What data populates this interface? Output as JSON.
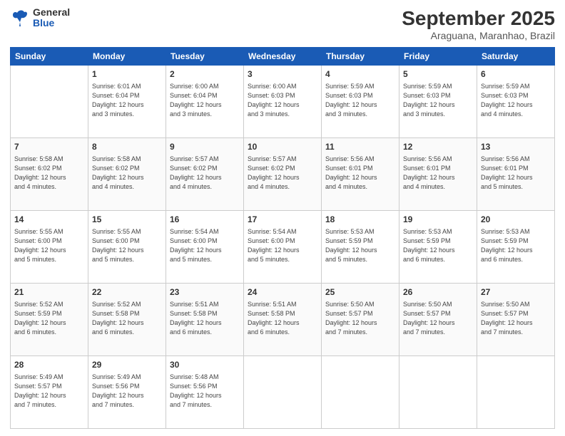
{
  "logo": {
    "general": "General",
    "blue": "Blue"
  },
  "title": "September 2025",
  "subtitle": "Araguana, Maranhao, Brazil",
  "days_of_week": [
    "Sunday",
    "Monday",
    "Tuesday",
    "Wednesday",
    "Thursday",
    "Friday",
    "Saturday"
  ],
  "weeks": [
    [
      {
        "day": "",
        "info": ""
      },
      {
        "day": "1",
        "info": "Sunrise: 6:01 AM\nSunset: 6:04 PM\nDaylight: 12 hours\nand 3 minutes."
      },
      {
        "day": "2",
        "info": "Sunrise: 6:00 AM\nSunset: 6:04 PM\nDaylight: 12 hours\nand 3 minutes."
      },
      {
        "day": "3",
        "info": "Sunrise: 6:00 AM\nSunset: 6:03 PM\nDaylight: 12 hours\nand 3 minutes."
      },
      {
        "day": "4",
        "info": "Sunrise: 5:59 AM\nSunset: 6:03 PM\nDaylight: 12 hours\nand 3 minutes."
      },
      {
        "day": "5",
        "info": "Sunrise: 5:59 AM\nSunset: 6:03 PM\nDaylight: 12 hours\nand 3 minutes."
      },
      {
        "day": "6",
        "info": "Sunrise: 5:59 AM\nSunset: 6:03 PM\nDaylight: 12 hours\nand 4 minutes."
      }
    ],
    [
      {
        "day": "7",
        "info": "Sunrise: 5:58 AM\nSunset: 6:02 PM\nDaylight: 12 hours\nand 4 minutes."
      },
      {
        "day": "8",
        "info": "Sunrise: 5:58 AM\nSunset: 6:02 PM\nDaylight: 12 hours\nand 4 minutes."
      },
      {
        "day": "9",
        "info": "Sunrise: 5:57 AM\nSunset: 6:02 PM\nDaylight: 12 hours\nand 4 minutes."
      },
      {
        "day": "10",
        "info": "Sunrise: 5:57 AM\nSunset: 6:02 PM\nDaylight: 12 hours\nand 4 minutes."
      },
      {
        "day": "11",
        "info": "Sunrise: 5:56 AM\nSunset: 6:01 PM\nDaylight: 12 hours\nand 4 minutes."
      },
      {
        "day": "12",
        "info": "Sunrise: 5:56 AM\nSunset: 6:01 PM\nDaylight: 12 hours\nand 4 minutes."
      },
      {
        "day": "13",
        "info": "Sunrise: 5:56 AM\nSunset: 6:01 PM\nDaylight: 12 hours\nand 5 minutes."
      }
    ],
    [
      {
        "day": "14",
        "info": "Sunrise: 5:55 AM\nSunset: 6:00 PM\nDaylight: 12 hours\nand 5 minutes."
      },
      {
        "day": "15",
        "info": "Sunrise: 5:55 AM\nSunset: 6:00 PM\nDaylight: 12 hours\nand 5 minutes."
      },
      {
        "day": "16",
        "info": "Sunrise: 5:54 AM\nSunset: 6:00 PM\nDaylight: 12 hours\nand 5 minutes."
      },
      {
        "day": "17",
        "info": "Sunrise: 5:54 AM\nSunset: 6:00 PM\nDaylight: 12 hours\nand 5 minutes."
      },
      {
        "day": "18",
        "info": "Sunrise: 5:53 AM\nSunset: 5:59 PM\nDaylight: 12 hours\nand 5 minutes."
      },
      {
        "day": "19",
        "info": "Sunrise: 5:53 AM\nSunset: 5:59 PM\nDaylight: 12 hours\nand 6 minutes."
      },
      {
        "day": "20",
        "info": "Sunrise: 5:53 AM\nSunset: 5:59 PM\nDaylight: 12 hours\nand 6 minutes."
      }
    ],
    [
      {
        "day": "21",
        "info": "Sunrise: 5:52 AM\nSunset: 5:59 PM\nDaylight: 12 hours\nand 6 minutes."
      },
      {
        "day": "22",
        "info": "Sunrise: 5:52 AM\nSunset: 5:58 PM\nDaylight: 12 hours\nand 6 minutes."
      },
      {
        "day": "23",
        "info": "Sunrise: 5:51 AM\nSunset: 5:58 PM\nDaylight: 12 hours\nand 6 minutes."
      },
      {
        "day": "24",
        "info": "Sunrise: 5:51 AM\nSunset: 5:58 PM\nDaylight: 12 hours\nand 6 minutes."
      },
      {
        "day": "25",
        "info": "Sunrise: 5:50 AM\nSunset: 5:57 PM\nDaylight: 12 hours\nand 7 minutes."
      },
      {
        "day": "26",
        "info": "Sunrise: 5:50 AM\nSunset: 5:57 PM\nDaylight: 12 hours\nand 7 minutes."
      },
      {
        "day": "27",
        "info": "Sunrise: 5:50 AM\nSunset: 5:57 PM\nDaylight: 12 hours\nand 7 minutes."
      }
    ],
    [
      {
        "day": "28",
        "info": "Sunrise: 5:49 AM\nSunset: 5:57 PM\nDaylight: 12 hours\nand 7 minutes."
      },
      {
        "day": "29",
        "info": "Sunrise: 5:49 AM\nSunset: 5:56 PM\nDaylight: 12 hours\nand 7 minutes."
      },
      {
        "day": "30",
        "info": "Sunrise: 5:48 AM\nSunset: 5:56 PM\nDaylight: 12 hours\nand 7 minutes."
      },
      {
        "day": "",
        "info": ""
      },
      {
        "day": "",
        "info": ""
      },
      {
        "day": "",
        "info": ""
      },
      {
        "day": "",
        "info": ""
      }
    ]
  ]
}
